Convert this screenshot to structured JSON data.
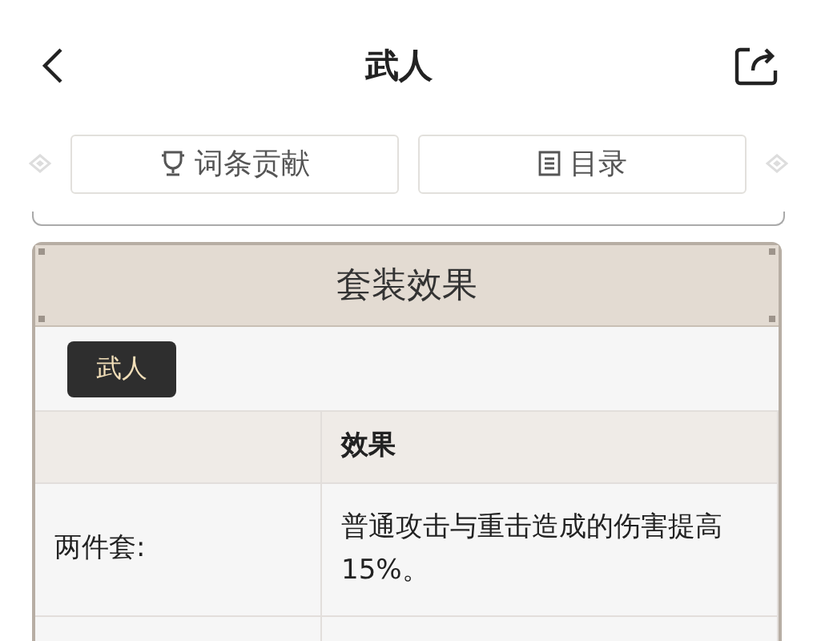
{
  "header": {
    "title": "武人"
  },
  "nav_buttons": [
    {
      "kind": "trophy",
      "label": "词条贡献"
    },
    {
      "kind": "list",
      "label": "目录"
    }
  ],
  "panel": {
    "title": "套装效果",
    "tabs": [
      {
        "label": "武人",
        "selected": true
      }
    ],
    "table": {
      "columns": [
        "",
        "效果"
      ],
      "rows": [
        {
          "cells": [
            "两件套:",
            "普通攻击与重击造成的伤害提高15%。"
          ]
        },
        {
          "cells": [
            "",
            ""
          ]
        }
      ]
    }
  }
}
